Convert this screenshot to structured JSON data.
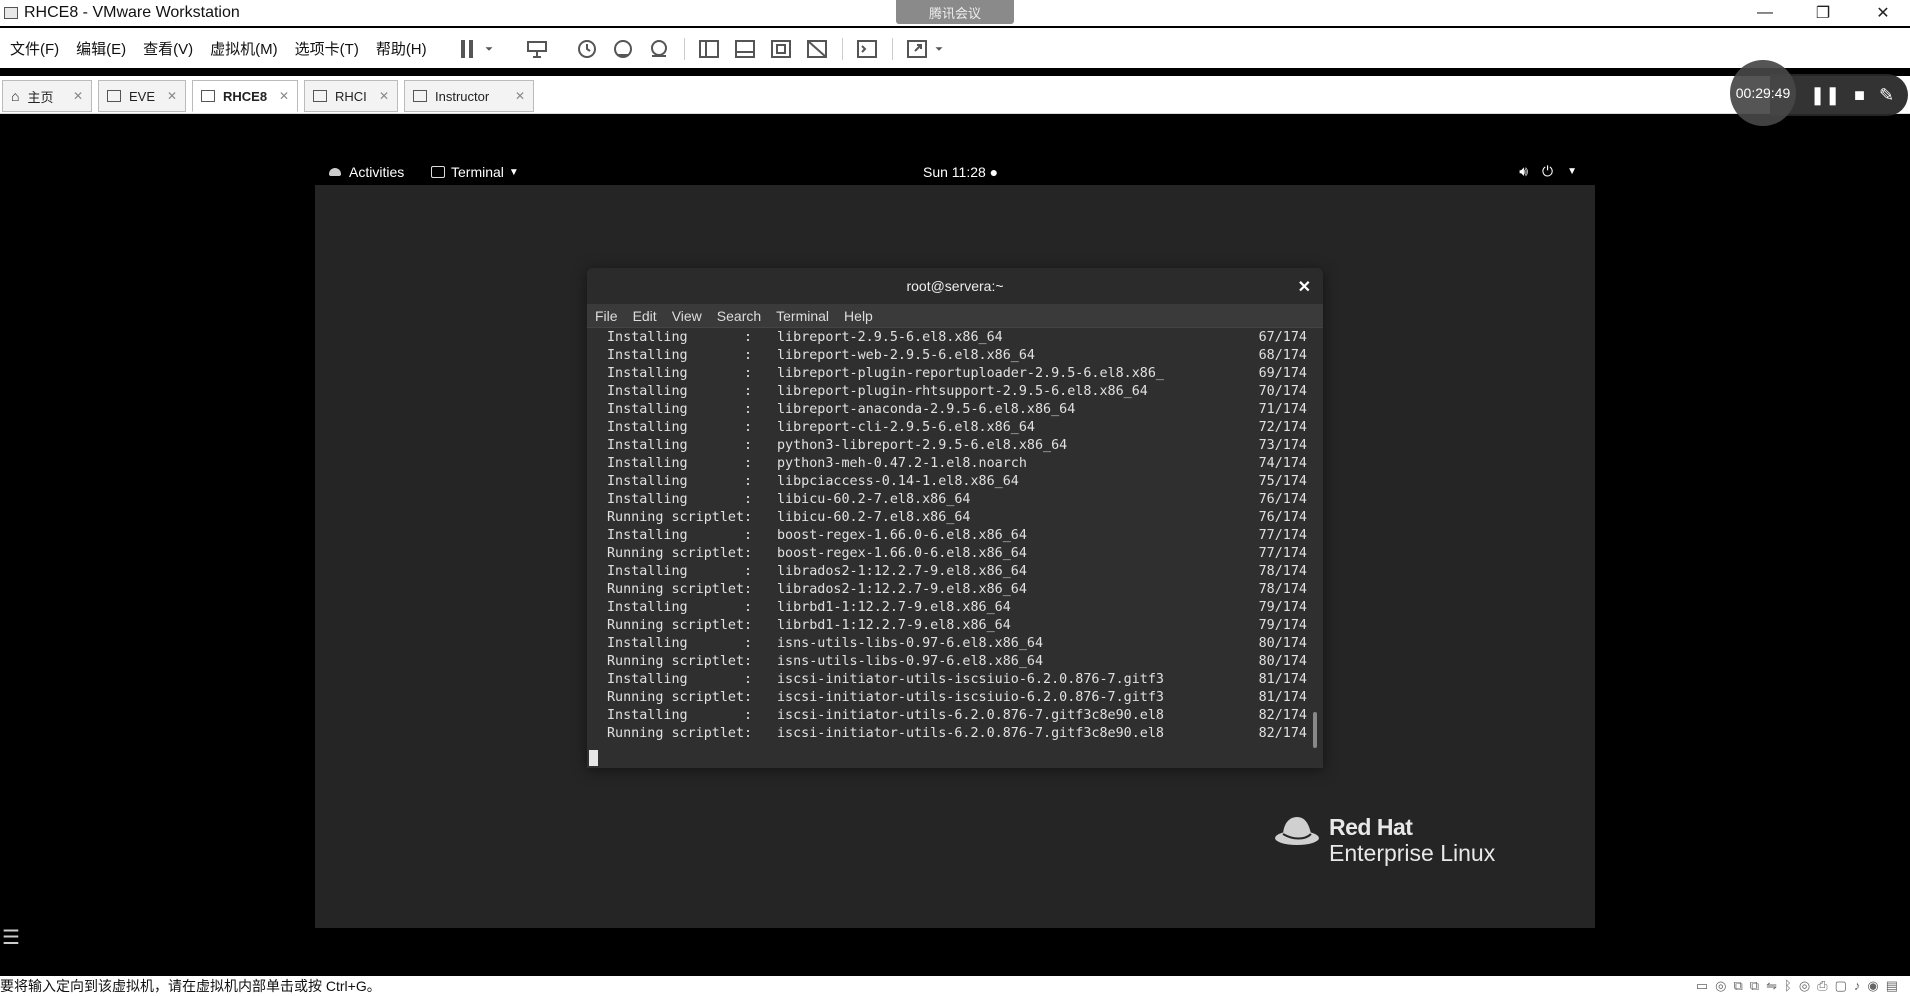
{
  "window": {
    "title": "RHCE8 - VMware Workstation",
    "meeting_label": "腾讯会议",
    "controls": {
      "minimize": "—",
      "restore": "❐",
      "close": "✕"
    }
  },
  "menu": [
    "文件(F)",
    "编辑(E)",
    "查看(V)",
    "虚拟机(M)",
    "选项卡(T)",
    "帮助(H)"
  ],
  "tabs": [
    {
      "label": "主页",
      "icon": "home-icon"
    },
    {
      "label": "EVE",
      "icon": "vm-icon"
    },
    {
      "label": "RHCE8",
      "icon": "vm-icon",
      "active": true
    },
    {
      "label": "RHCI",
      "icon": "vm-icon"
    },
    {
      "label": "Instructor",
      "icon": "vm-icon"
    }
  ],
  "recorder": {
    "time": "00:29:49"
  },
  "gnome": {
    "activities": "Activities",
    "app_menu": "Terminal",
    "clock": "Sun 11:28 ●"
  },
  "terminal": {
    "title": "root@servera:~",
    "menu": [
      "File",
      "Edit",
      "View",
      "Search",
      "Terminal",
      "Help"
    ],
    "lines": [
      {
        "action": "Installing       :",
        "pkg": "libreport-2.9.5-6.el8.x86_64",
        "count": "67/174"
      },
      {
        "action": "Installing       :",
        "pkg": "libreport-web-2.9.5-6.el8.x86_64",
        "count": "68/174"
      },
      {
        "action": "Installing       :",
        "pkg": "libreport-plugin-reportuploader-2.9.5-6.el8.x86_",
        "count": "69/174"
      },
      {
        "action": "Installing       :",
        "pkg": "libreport-plugin-rhtsupport-2.9.5-6.el8.x86_64",
        "count": "70/174"
      },
      {
        "action": "Installing       :",
        "pkg": "libreport-anaconda-2.9.5-6.el8.x86_64",
        "count": "71/174"
      },
      {
        "action": "Installing       :",
        "pkg": "libreport-cli-2.9.5-6.el8.x86_64",
        "count": "72/174"
      },
      {
        "action": "Installing       :",
        "pkg": "python3-libreport-2.9.5-6.el8.x86_64",
        "count": "73/174"
      },
      {
        "action": "Installing       :",
        "pkg": "python3-meh-0.47.2-1.el8.noarch",
        "count": "74/174"
      },
      {
        "action": "Installing       :",
        "pkg": "libpciaccess-0.14-1.el8.x86_64",
        "count": "75/174"
      },
      {
        "action": "Installing       :",
        "pkg": "libicu-60.2-7.el8.x86_64",
        "count": "76/174"
      },
      {
        "action": "Running scriptlet:",
        "pkg": "libicu-60.2-7.el8.x86_64",
        "count": "76/174"
      },
      {
        "action": "Installing       :",
        "pkg": "boost-regex-1.66.0-6.el8.x86_64",
        "count": "77/174"
      },
      {
        "action": "Running scriptlet:",
        "pkg": "boost-regex-1.66.0-6.el8.x86_64",
        "count": "77/174"
      },
      {
        "action": "Installing       :",
        "pkg": "librados2-1:12.2.7-9.el8.x86_64",
        "count": "78/174"
      },
      {
        "action": "Running scriptlet:",
        "pkg": "librados2-1:12.2.7-9.el8.x86_64",
        "count": "78/174"
      },
      {
        "action": "Installing       :",
        "pkg": "librbd1-1:12.2.7-9.el8.x86_64",
        "count": "79/174"
      },
      {
        "action": "Running scriptlet:",
        "pkg": "librbd1-1:12.2.7-9.el8.x86_64",
        "count": "79/174"
      },
      {
        "action": "Installing       :",
        "pkg": "isns-utils-libs-0.97-6.el8.x86_64",
        "count": "80/174"
      },
      {
        "action": "Running scriptlet:",
        "pkg": "isns-utils-libs-0.97-6.el8.x86_64",
        "count": "80/174"
      },
      {
        "action": "Installing       :",
        "pkg": "iscsi-initiator-utils-iscsiuio-6.2.0.876-7.gitf3",
        "count": "81/174"
      },
      {
        "action": "Running scriptlet:",
        "pkg": "iscsi-initiator-utils-iscsiuio-6.2.0.876-7.gitf3",
        "count": "81/174"
      },
      {
        "action": "Installing       :",
        "pkg": "iscsi-initiator-utils-6.2.0.876-7.gitf3c8e90.el8",
        "count": "82/174"
      },
      {
        "action": "Running scriptlet:",
        "pkg": "iscsi-initiator-utils-6.2.0.876-7.gitf3c8e90.el8",
        "count": "82/174"
      }
    ]
  },
  "branding": {
    "line1": "Red Hat",
    "line2": "Enterprise Linux"
  },
  "status": {
    "text": "要将输入定向到该虚拟机，请在虚拟机内部单击或按 Ctrl+G。"
  }
}
